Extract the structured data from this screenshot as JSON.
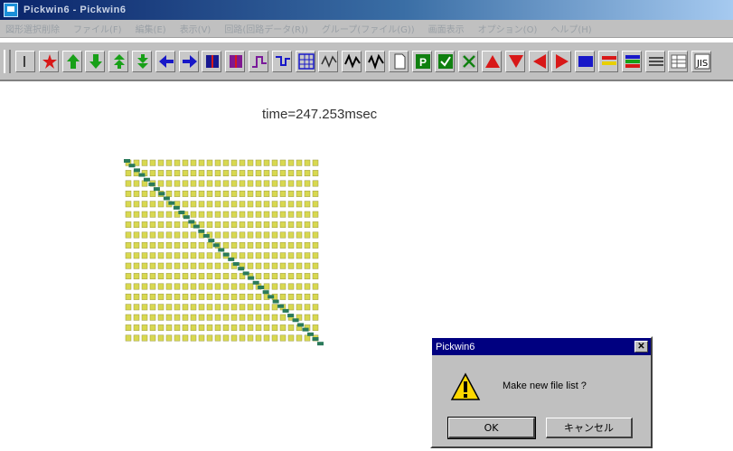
{
  "window": {
    "title": "Pickwin6 - Pickwin6"
  },
  "menu": [
    "図形選択削除",
    "ファイル(F)",
    "編集(E)",
    "表示(V)",
    "回路(回路データ(R))",
    "グループ(ファイル(G))",
    "画面表示",
    "オプション(O)",
    "ヘルプ(H)"
  ],
  "toolbar": {
    "buttons": [
      {
        "name": "select-icon",
        "color": "#c0c0c0"
      },
      {
        "name": "star-icon",
        "color": "#d81818"
      },
      {
        "name": "arrow-up-icon",
        "color": "#18a018"
      },
      {
        "name": "arrow-down-icon",
        "color": "#18a018"
      },
      {
        "name": "arrow-up-double-icon",
        "color": "#18a018"
      },
      {
        "name": "arrow-down-double-icon",
        "color": "#18a018"
      },
      {
        "name": "arrow-left-icon",
        "color": "#1818c8"
      },
      {
        "name": "arrow-right-icon",
        "color": "#1818c8"
      },
      {
        "name": "block-blue-icon",
        "color": "#181890"
      },
      {
        "name": "block-purple-icon",
        "color": "#801890"
      },
      {
        "name": "step-icon",
        "color": "#7a1a9a"
      },
      {
        "name": "step-down-icon",
        "color": "#1818c8"
      },
      {
        "name": "grid-icon",
        "color": "#1818c8"
      },
      {
        "name": "wave-icon",
        "color": "#303030"
      },
      {
        "name": "wave-active-icon",
        "color": "#000000"
      },
      {
        "name": "wave-alt-icon",
        "color": "#000000"
      },
      {
        "name": "document-icon",
        "color": "#c0c0c0"
      },
      {
        "name": "p-icon",
        "color": "#108010"
      },
      {
        "name": "check-icon",
        "color": "#108010"
      },
      {
        "name": "cross-icon",
        "color": "#108010"
      },
      {
        "name": "triangle-up-icon",
        "color": "#d81818"
      },
      {
        "name": "triangle-down-icon",
        "color": "#d81818"
      },
      {
        "name": "triangle-left-icon",
        "color": "#d81818"
      },
      {
        "name": "triangle-right-icon",
        "color": "#d81818"
      },
      {
        "name": "square-blue-icon",
        "color": "#1818c8"
      },
      {
        "name": "stripes-icon",
        "color": "#d81818"
      },
      {
        "name": "stripes-multi-icon",
        "color": "#1818c8"
      },
      {
        "name": "lines-icon",
        "color": "#202020"
      },
      {
        "name": "table-icon",
        "color": "#606060"
      },
      {
        "name": "scroll-icon",
        "color": "#404040"
      }
    ]
  },
  "main": {
    "time_label": "time=247.253msec",
    "matrix": {
      "rows": 18,
      "cols": 24,
      "cell_color": "#d8d850",
      "diag_color": "#2a7a5a"
    }
  },
  "dialog": {
    "title": "Pickwin6",
    "close_glyph": "✕",
    "message": "Make new file list ?",
    "ok_label": "OK",
    "cancel_label": "キャンセル",
    "icon": "warning-icon"
  }
}
